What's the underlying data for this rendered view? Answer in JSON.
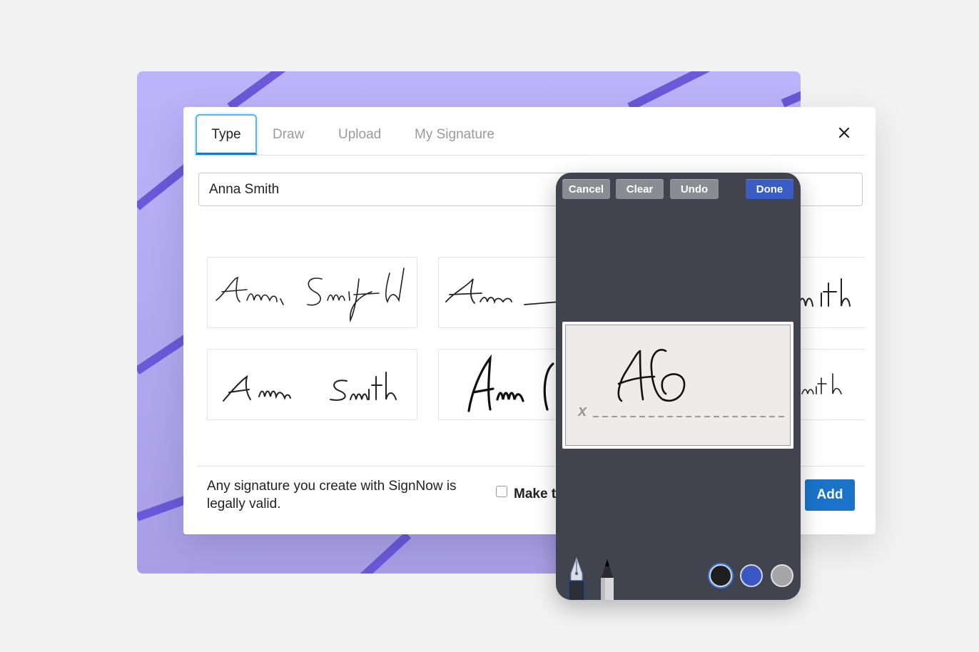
{
  "tabs": [
    {
      "label": "Type",
      "active": true
    },
    {
      "label": "Draw",
      "active": false
    },
    {
      "label": "Upload",
      "active": false
    },
    {
      "label": "My Signature",
      "active": false
    }
  ],
  "name_input": {
    "value": "Anna Smith"
  },
  "footer": {
    "legal_text": "Any signature you create with SignNow is legally valid.",
    "default_label": "Make t",
    "add_label": "Add"
  },
  "pad": {
    "cancel_label": "Cancel",
    "clear_label": "Clear",
    "undo_label": "Undo",
    "done_label": "Done",
    "baseline_mark": "x",
    "tools": [
      "fountain-pen-icon",
      "marker-pen-icon"
    ],
    "colors": [
      "#1e1e1e",
      "#3a55c4",
      "#a6a6a8"
    ],
    "selected_color": "#1e1e1e"
  },
  "colors": {
    "accent": "#1a73c9",
    "tab_focus": "#5ab6ef",
    "background_card": "#bcb3fb",
    "pad_background": "#41444e"
  },
  "icons": {
    "close": "close-icon"
  }
}
